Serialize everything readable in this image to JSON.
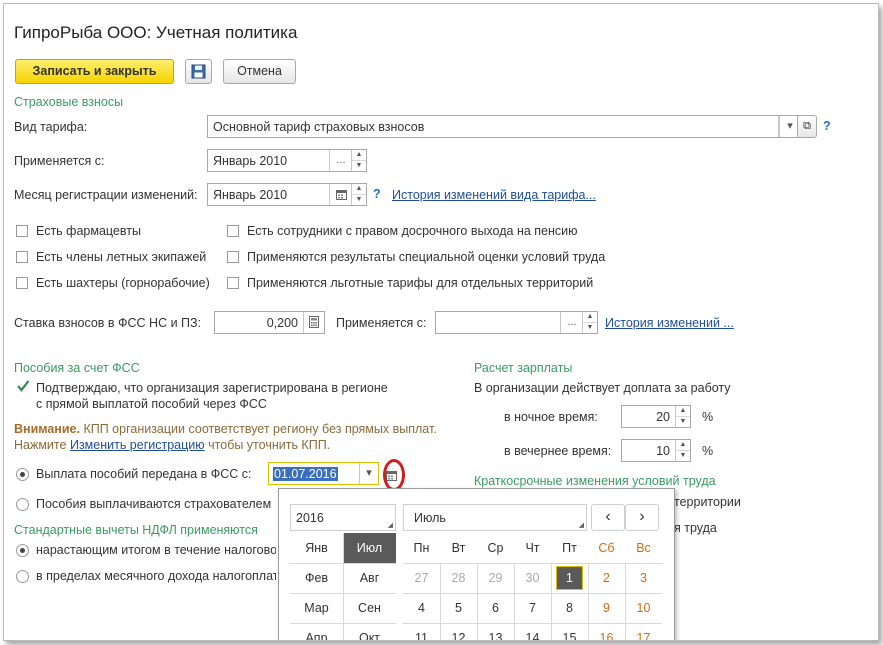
{
  "window": {
    "title": "ГипроРыба ООО: Учетная политика"
  },
  "toolbar": {
    "save_close": "Записать и закрыть",
    "save_icon": "floppy-disk-icon",
    "cancel": "Отмена"
  },
  "insurance": {
    "section": "Страховые взносы",
    "tariff_label": "Вид тарифа:",
    "tariff_value": "Основной тариф страховых взносов",
    "applies_label": "Применяется с:",
    "applies_value": "Январь 2010",
    "month_reg_label": "Месяц регистрации изменений:",
    "month_reg_value": "Январь 2010",
    "history_link": "История изменений вида тарифа...",
    "help": "?",
    "checkboxes_left": [
      "Есть фармацевты",
      "Есть члены летных экипажей",
      "Есть шахтеры (горнорабочие)"
    ],
    "checkboxes_right": [
      "Есть сотрудники с правом досрочного выхода на пенсию",
      "Применяются результаты специальной оценки условий труда",
      "Применяются льготные тарифы для отдельных территорий"
    ],
    "fss_rate_label": "Ставка взносов в ФСС НС и ПЗ:",
    "fss_rate_value": "0,200",
    "applies2_label": "Применяется с:",
    "applies2_value": "",
    "history2_link": "История изменений ..."
  },
  "benefits": {
    "section": "Пособия за счет ФСС",
    "confirm_line1": "Подтверждаю, что организация зарегистрирована в регионе",
    "confirm_line2": "с прямой выплатой пособий через ФСС",
    "warn_title": "Внимание.",
    "warn_text": "КПП организации соответствует региону без прямых выплат.",
    "warn_prefix": "Нажмите",
    "warn_link": "Изменить регистрацию",
    "warn_suffix": "чтобы уточнить КПП.",
    "radio1_label": "Выплата пособий передана в ФСС с:",
    "radio1_date": "01.07.2016",
    "radio2_label": "Пособия выплачиваются страхователем"
  },
  "ndfl": {
    "section": "Стандартные вычеты НДФЛ применяются",
    "radio1": "нарастающим итогом в течение налогового периода",
    "radio2": "в пределах месячного дохода налогоплательщика"
  },
  "salary": {
    "section": "Расчет зарплаты",
    "line": "В организации действует доплата за работу",
    "night_label": "в ночное время:",
    "night_value": "20",
    "evening_label": "в вечернее время:",
    "evening_value": "10",
    "pct": "%",
    "short_term_section": "Краткосрочные изменения условий труда",
    "partial1": "территории",
    "partial2": "я труда"
  },
  "calendar": {
    "year": "2016",
    "month": "Июль",
    "prev": "‹",
    "next": "›",
    "months": [
      "Янв",
      "Июл",
      "Фев",
      "Авг",
      "Мар",
      "Сен",
      "Апр",
      "Окт"
    ],
    "weekdays": [
      "Пн",
      "Вт",
      "Ср",
      "Чт",
      "Пт",
      "Сб",
      "Вс"
    ],
    "week1": [
      "27",
      "28",
      "29",
      "30",
      "1",
      "2",
      "3"
    ],
    "week2": [
      "4",
      "5",
      "6",
      "7",
      "8",
      "9",
      "10"
    ],
    "week3": [
      "11",
      "12",
      "13",
      "14",
      "15",
      "16",
      "17"
    ],
    "selected_day": "1",
    "selected_month": "Июл"
  },
  "colors": {
    "accent_green": "#3a9b62",
    "link_blue": "#1f4e9c",
    "primary_yellow": "#f5d300",
    "weekend_orange": "#d86a10",
    "highlight_ring": "#d21d1d"
  }
}
